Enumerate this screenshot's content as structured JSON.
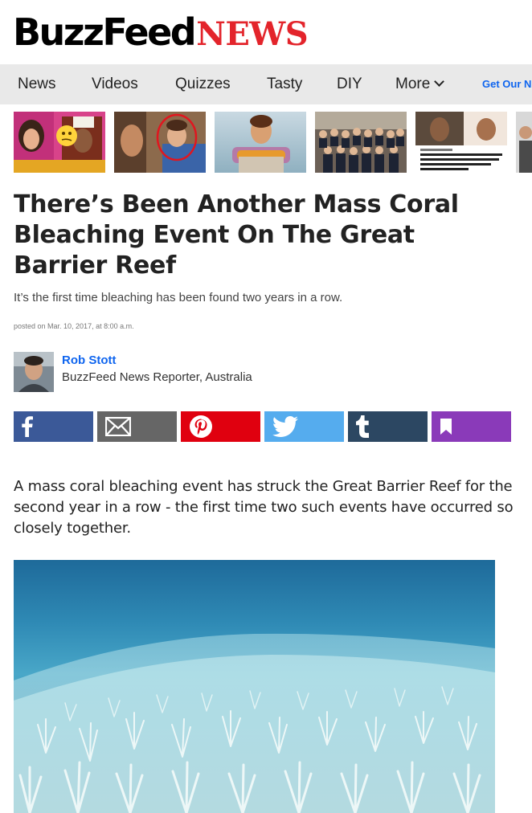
{
  "brand": {
    "logo_primary": "BuzzFeed",
    "logo_secondary": "NEWS"
  },
  "nav": {
    "items": [
      {
        "label": "News"
      },
      {
        "label": "Videos"
      },
      {
        "label": "Quizzes"
      },
      {
        "label": "Tasty"
      },
      {
        "label": "DIY"
      },
      {
        "label": "More"
      }
    ],
    "cta": "Get Our N"
  },
  "article": {
    "headline": "There’s Been Another Mass Coral Bleaching Event On The Great Barrier Reef",
    "dek": "It’s the first time bleaching has been found two years in a row.",
    "posted": "posted on Mar. 10, 2017, at 8:00 a.m.",
    "author": {
      "name": "Rob Stott",
      "role": "BuzzFeed News Reporter, Australia"
    },
    "lede": "A mass coral bleaching event has struck the Great Barrier Reef for the second year in a row - the first time two such events have occurred so closely together."
  },
  "share": [
    {
      "name": "facebook",
      "color": "#3b5998",
      "icon": "facebook-icon"
    },
    {
      "name": "email",
      "color": "#666666",
      "icon": "mail-icon"
    },
    {
      "name": "pinterest",
      "color": "#e0000f",
      "icon": "pinterest-icon"
    },
    {
      "name": "twitter",
      "color": "#55acee",
      "icon": "twitter-icon"
    },
    {
      "name": "tumblr",
      "color": "#2c4762",
      "icon": "tumblr-icon"
    },
    {
      "name": "bookmark",
      "color": "#8a3ab9",
      "icon": "bookmark-icon"
    }
  ],
  "colors": {
    "accent_red": "#e3242b",
    "link_blue": "#0f65ef",
    "nav_bg": "#e9e9e9"
  }
}
